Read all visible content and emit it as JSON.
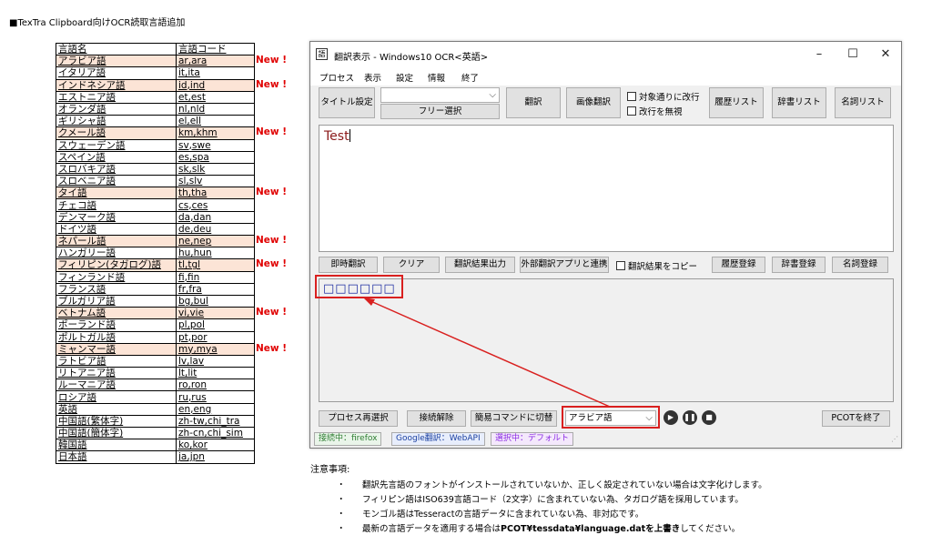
{
  "page_title": "■TexTra Clipboard向けOCR読取言語追加",
  "table": {
    "header": [
      "言語名",
      "言語コード"
    ],
    "rows": [
      {
        "name": "アラビア語",
        "code": "ar,ara",
        "new": true
      },
      {
        "name": "イタリア語",
        "code": "it,ita",
        "new": false
      },
      {
        "name": "インドネシア語",
        "code": "id,ind",
        "new": true
      },
      {
        "name": "エストニア語",
        "code": "et,est",
        "new": false
      },
      {
        "name": "オランダ語",
        "code": "nl,nld",
        "new": false
      },
      {
        "name": "ギリシャ語",
        "code": "el,ell",
        "new": false
      },
      {
        "name": "クメール語",
        "code": "km,khm",
        "new": true
      },
      {
        "name": "スウェーデン語",
        "code": "sv,swe",
        "new": false
      },
      {
        "name": "スペイン語",
        "code": "es,spa",
        "new": false
      },
      {
        "name": "スロバキア語",
        "code": "sk,slk",
        "new": false
      },
      {
        "name": "スロベニア語",
        "code": "sl,slv",
        "new": false
      },
      {
        "name": "タイ語",
        "code": "th,tha",
        "new": true
      },
      {
        "name": "チェコ語",
        "code": "cs,ces",
        "new": false
      },
      {
        "name": "デンマーク語",
        "code": "da,dan",
        "new": false
      },
      {
        "name": "ドイツ語",
        "code": "de,deu",
        "new": false
      },
      {
        "name": "ネパール語",
        "code": "ne,nep",
        "new": true
      },
      {
        "name": "ハンガリー語",
        "code": "hu,hun",
        "new": false
      },
      {
        "name": "フィリピン(タガログ)語",
        "code": "tl,tgl",
        "new": true
      },
      {
        "name": "フィンランド語",
        "code": "fi,fin",
        "new": false
      },
      {
        "name": "フランス語",
        "code": "fr,fra",
        "new": false
      },
      {
        "name": "ブルガリア語",
        "code": "bg,bul",
        "new": false
      },
      {
        "name": "ベトナム語",
        "code": "vi,vie",
        "new": true
      },
      {
        "name": "ポーランド語",
        "code": "pl,pol",
        "new": false
      },
      {
        "name": "ポルトガル語",
        "code": "pt,por",
        "new": false
      },
      {
        "name": "ミャンマー語",
        "code": "my,mya",
        "new": true
      },
      {
        "name": "ラトビア語",
        "code": "lv,lav",
        "new": false
      },
      {
        "name": "リトアニア語",
        "code": "lt,lit",
        "new": false
      },
      {
        "name": "ルーマニア語",
        "code": "ro,ron",
        "new": false
      },
      {
        "name": "ロシア語",
        "code": "ru,rus",
        "new": false
      },
      {
        "name": "英語",
        "code": "en,eng",
        "new": false
      },
      {
        "name": "中国語(繁体字)",
        "code": "zh-tw,chi_tra",
        "new": false
      },
      {
        "name": "中国語(簡体字)",
        "code": "zh-cn,chi_sim",
        "new": false
      },
      {
        "name": "韓国語",
        "code": "ko,kor",
        "new": false
      },
      {
        "name": "日本語",
        "code": "ja,jpn",
        "new": false
      }
    ],
    "new_label": "New !"
  },
  "window": {
    "title": "翻訳表示 - Windows10 OCR<英語>",
    "icon_glyph": "語",
    "controls": {
      "minimize": "–",
      "maximize": "☐",
      "close": "✕"
    },
    "menu": [
      "プロセス",
      "表示",
      "設定",
      "情報",
      "終了"
    ],
    "toolbar": {
      "title_setting": "タイトル設定",
      "combo_value": "",
      "free_select": "フリー選択",
      "translate": "翻訳",
      "image_translate": "画像翻訳",
      "chk_line_break": "対象通りに改行",
      "chk_ignore_break": "改行を無視",
      "history_list": "履歴リスト",
      "dict_list": "辞書リスト",
      "noun_list": "名詞リスト"
    },
    "input_text": "Test",
    "mid_bar": {
      "instant": "即時翻訳",
      "clear": "クリア",
      "output": "翻訳結果出力",
      "external": "外部翻訳アプリと連携",
      "chk_copy": "翻訳結果をコピー",
      "history_reg": "履歴登録",
      "dict_reg": "辞書登録",
      "noun_reg": "名詞登録"
    },
    "output_text": "□□□□□□",
    "bottom_bar": {
      "reselect": "プロセス再選択",
      "disconnect": "接続解除",
      "simple_cmd": "簡易コマンドに切替",
      "lang_select": "アラビア語",
      "end_pcot": "PCOTを終了"
    },
    "status": {
      "connected": "接続中：firefox",
      "engine": "Google翻訳：WebAPI",
      "selected": "選択中：デフォルト"
    },
    "accent_red": "#d9201f"
  },
  "notes": {
    "heading": "注意事項:",
    "bullet": "・",
    "items": [
      "翻訳先言語のフォントがインストールされていないか、正しく設定されていない場合は文字化けします。",
      "フィリピン語はISO639言語コード（2文字）に含まれていない為、タガログ語を採用しています。",
      "モンゴル語はTesseractの言語データに含まれていない為、非対応です。"
    ],
    "last": {
      "pre": "最新の言語データを適用する場合は",
      "bold": "PCOT¥tessdata¥language.datを上書き",
      "post": "してください。"
    }
  }
}
